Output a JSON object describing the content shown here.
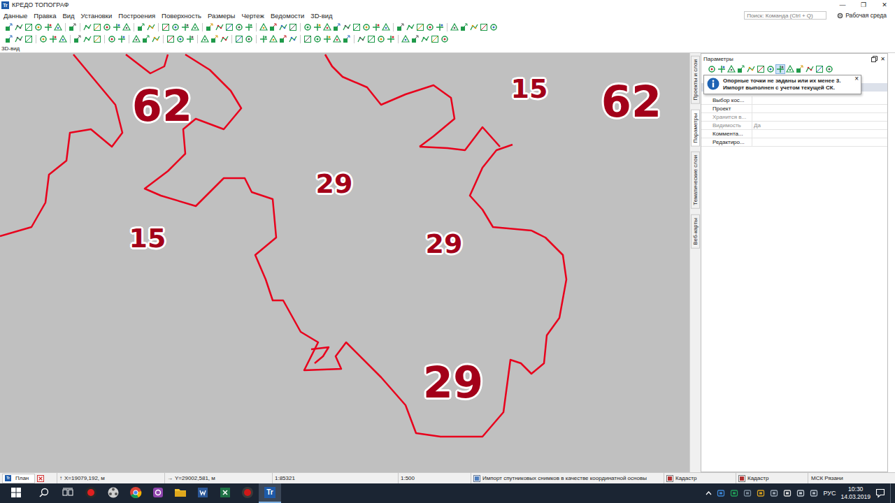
{
  "window": {
    "title": "КРЕДО ТОПОГРАФ",
    "logo": "Tr",
    "controls": [
      "—",
      "❐",
      "✕"
    ]
  },
  "menu": [
    "Данные",
    "Правка",
    "Вид",
    "Установки",
    "Построения",
    "Поверхность",
    "Размеры",
    "Чертеж",
    "Ведомости",
    "3D-вид"
  ],
  "search": {
    "placeholder": "Поиск: Команда (Ctrl + Q)"
  },
  "workspace": {
    "label": "Рабочая среда"
  },
  "view_tab": {
    "label": "3D-вид"
  },
  "map": {
    "labels": [
      {
        "text": "62",
        "kind": "large"
      },
      {
        "text": "15",
        "kind": "medium"
      },
      {
        "text": "62",
        "kind": "large"
      },
      {
        "text": "29",
        "kind": "medium"
      },
      {
        "text": "15",
        "kind": "medium"
      },
      {
        "text": "29",
        "kind": "medium"
      },
      {
        "text": "29",
        "kind": "large"
      }
    ]
  },
  "side_tabs": [
    {
      "label": "Проекты и слои",
      "selected": false
    },
    {
      "label": "Параметры",
      "selected": true
    },
    {
      "label": "Тематические слои",
      "selected": false
    },
    {
      "label": "Веб-карты",
      "selected": false
    }
  ],
  "panel": {
    "title": "Параметры",
    "close": "✕",
    "tools": [
      {
        "selected": false
      },
      {
        "selected": false
      },
      {
        "selected": false
      },
      {
        "selected": false
      },
      {
        "selected": false
      },
      {
        "selected": false
      },
      {
        "selected": false
      },
      {
        "selected": true
      },
      {
        "selected": false
      },
      {
        "selected": false
      },
      {
        "selected": false
      },
      {
        "selected": false
      },
      {
        "selected": false
      }
    ],
    "notice": {
      "lines": [
        "Опорные точки не заданы или их менее 3.",
        "Импорт выполнен с учетом текущей СК."
      ],
      "close": "×"
    },
    "properties": [
      {
        "label": "Выбор кос...",
        "value": "",
        "disabled": false
      },
      {
        "label": "Проект",
        "value": "",
        "disabled": false
      },
      {
        "label": "Хранится в...",
        "value": "",
        "disabled": true
      },
      {
        "label": "Видимость",
        "value": "Да",
        "disabled": true
      },
      {
        "label": "Коммента...",
        "value": "",
        "disabled": false
      },
      {
        "label": "Редактиро...",
        "value": "",
        "disabled": false
      }
    ]
  },
  "status_bar": {
    "view_tab": "План",
    "x": {
      "icon": "↑",
      "text": "X=19079,192, м"
    },
    "y": {
      "icon": "→",
      "text": "Y=29002,581, м"
    },
    "scale": "1:85321",
    "drawing_scale": "1:500",
    "task": "Импорт спутниковых снимков в качестве координатной основы",
    "layers": [
      "Кадастр",
      "Кадастр"
    ],
    "crs": "МСК Рязани"
  },
  "taskbar": {
    "apps": [
      {
        "kind": "red-disc",
        "selected": false
      },
      {
        "kind": "reel",
        "selected": false
      },
      {
        "kind": "chrome",
        "selected": false
      },
      {
        "kind": "purple",
        "selected": false
      },
      {
        "kind": "folder",
        "selected": false
      },
      {
        "kind": "word",
        "selected": false
      },
      {
        "kind": "excel",
        "selected": false
      },
      {
        "kind": "record",
        "selected": false
      },
      {
        "kind": "topograf",
        "selected": true
      }
    ],
    "language": "РУС",
    "time": "10:30",
    "date": "14.03.2019"
  }
}
